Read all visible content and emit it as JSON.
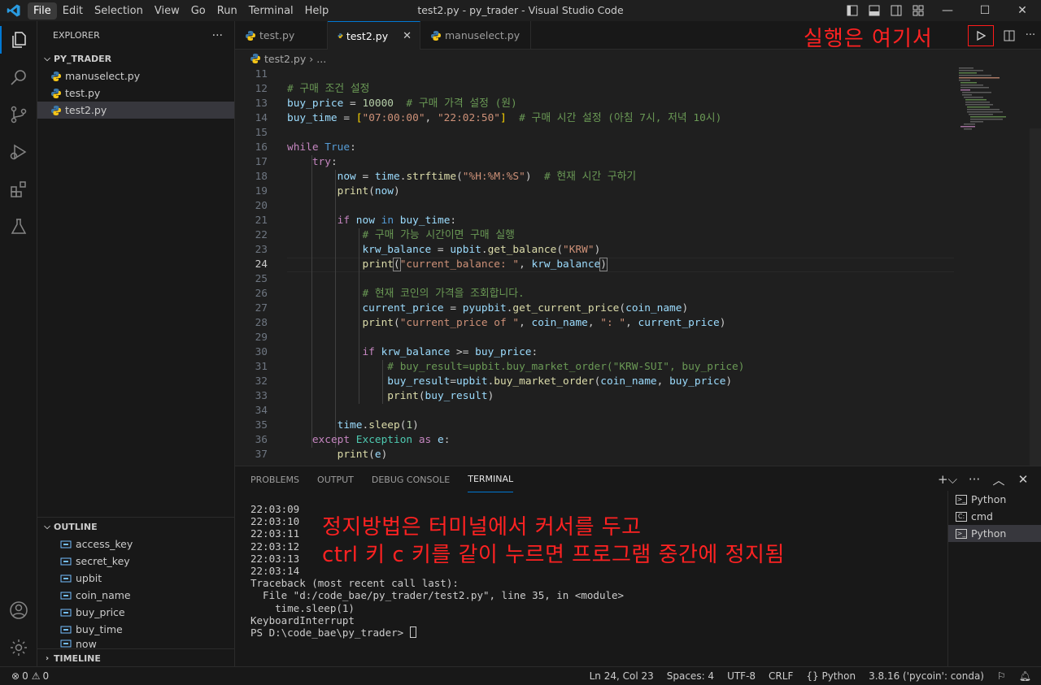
{
  "titlebar": {
    "menu": [
      "File",
      "Edit",
      "Selection",
      "View",
      "Go",
      "Run",
      "Terminal",
      "Help"
    ],
    "window_title": "test2.py - py_trader - Visual Studio Code"
  },
  "sidebar": {
    "header": "EXPLORER",
    "more": "···",
    "folder": "PY_TRADER",
    "files": [
      "manuselect.py",
      "test.py",
      "test2.py"
    ],
    "outline_title": "OUTLINE",
    "outline": [
      "access_key",
      "secret_key",
      "upbit",
      "coin_name",
      "buy_price",
      "buy_time",
      "now"
    ],
    "timeline_title": "TIMELINE"
  },
  "tabs": [
    {
      "label": "test.py"
    },
    {
      "label": "test2.py"
    },
    {
      "label": "manuselect.py"
    }
  ],
  "tab_close": "✕",
  "breadcrumb": {
    "file": "test2.py",
    "rest": "..."
  },
  "annotations": {
    "run": "실행은 여기서",
    "stop_line1": "정지방법은 터미널에서 커서를 두고",
    "stop_line2": "ctrl 키 c 키를 같이 누르면 프로그램 중간에 정지됨"
  },
  "editor": {
    "line_numbers": [
      "11",
      "12",
      "13",
      "14",
      "15",
      "16",
      "17",
      "18",
      "19",
      "20",
      "21",
      "22",
      "23",
      "24",
      "25",
      "26",
      "27",
      "28",
      "29",
      "30",
      "31",
      "32",
      "33",
      "34",
      "35",
      "36",
      "37"
    ],
    "current_line": "24"
  },
  "panel": {
    "tabs": [
      "PROBLEMS",
      "OUTPUT",
      "DEBUG CONSOLE",
      "TERMINAL"
    ],
    "terminal_lines": [
      "22:03:09",
      "22:03:10",
      "22:03:11",
      "22:03:12",
      "22:03:13",
      "22:03:14",
      "Traceback (most recent call last):",
      "  File \"d:/code_bae/py_trader/test2.py\", line 35, in <module>",
      "    time.sleep(1)",
      "KeyboardInterrupt",
      "PS D:\\code_bae\\py_trader> "
    ],
    "terminals": [
      "Python",
      "cmd",
      "Python"
    ]
  },
  "statusbar": {
    "errors": "0",
    "warnings": "0",
    "position": "Ln 24, Col 23",
    "spaces": "Spaces: 4",
    "encoding": "UTF-8",
    "eol": "CRLF",
    "language": "Python",
    "interpreter": "3.8.16 ('pycoin': conda)"
  }
}
